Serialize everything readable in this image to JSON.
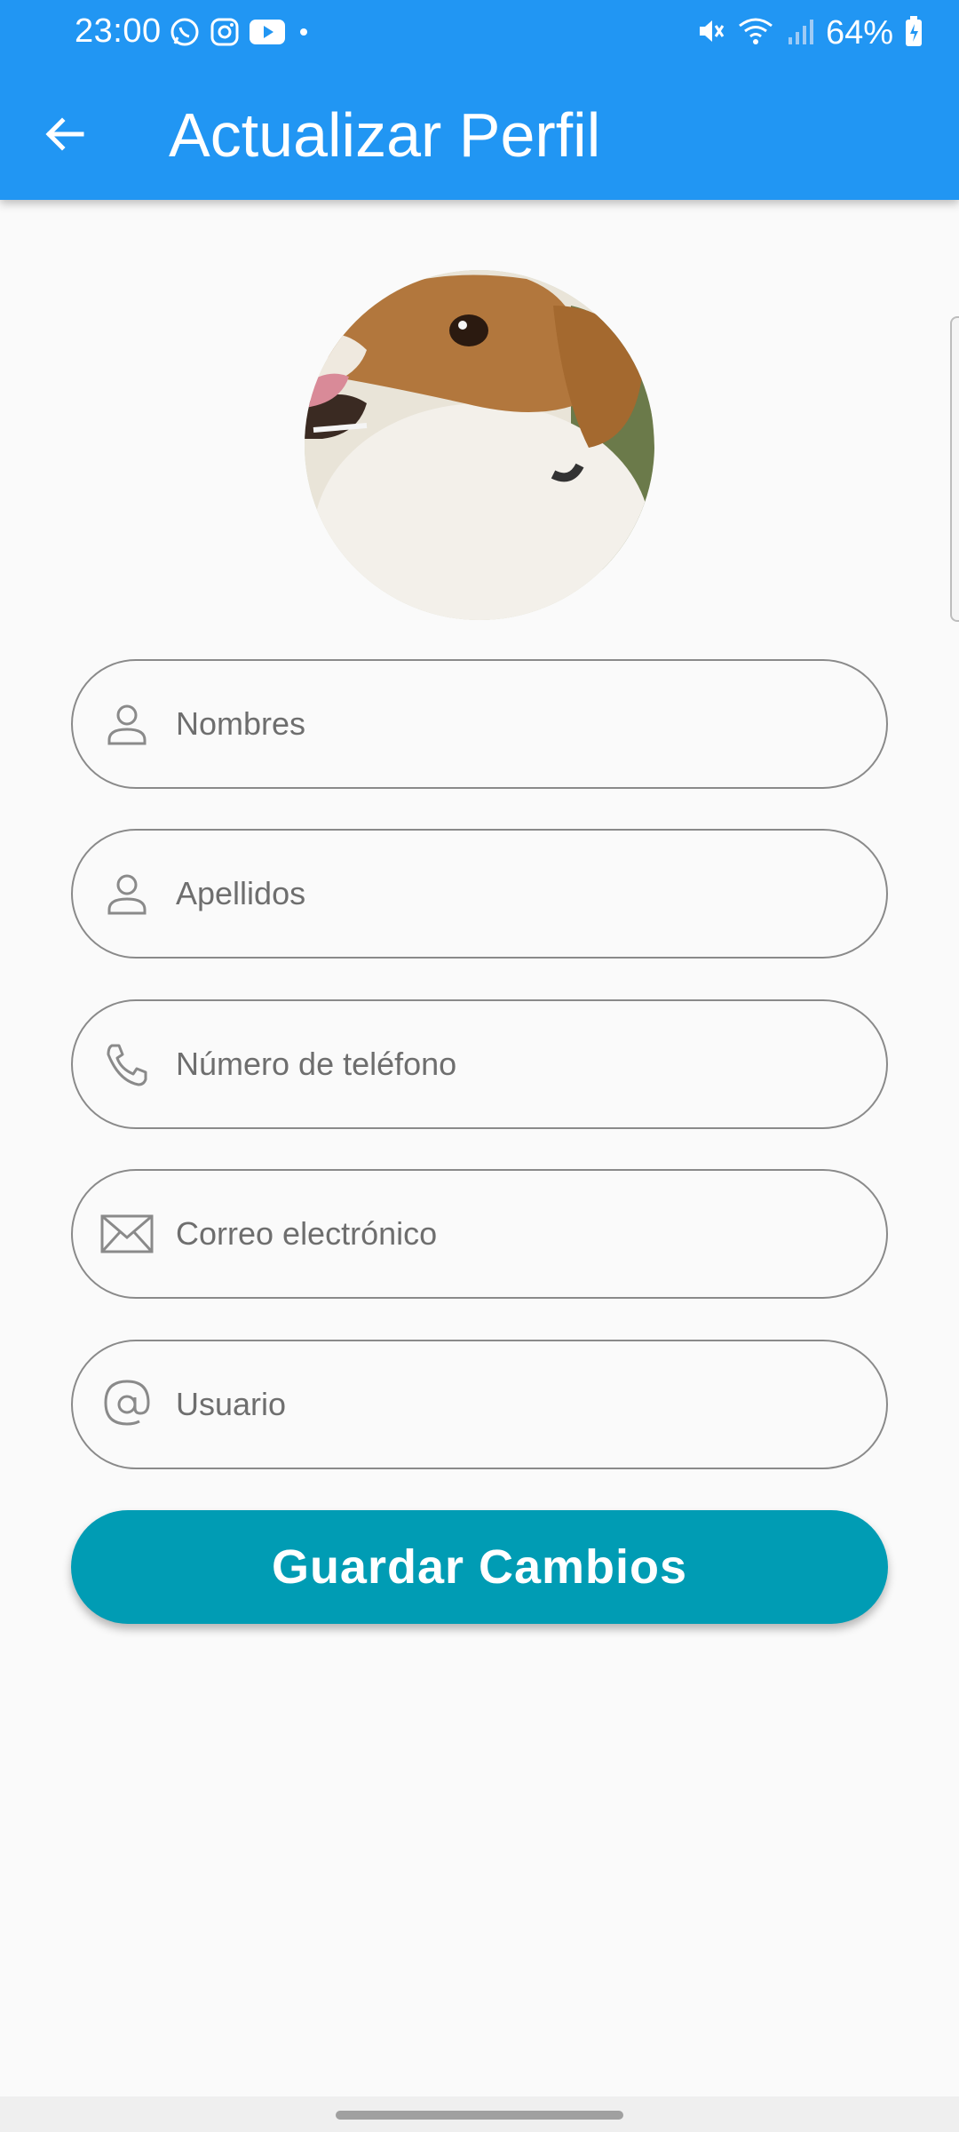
{
  "status_bar": {
    "time": "23:00",
    "battery": "64%",
    "left_icons": [
      "whatsapp-icon",
      "instagram-icon",
      "youtube-icon",
      "dot-icon"
    ],
    "right_icons": [
      "mute-icon",
      "wifi-icon",
      "signal-icon",
      "battery-icon"
    ]
  },
  "app_bar": {
    "title": "Actualizar Perfil",
    "back_icon": "arrow-back-icon",
    "color": "#2196f3"
  },
  "profile": {
    "avatar": "profile-photo"
  },
  "form": {
    "fields": [
      {
        "name": "nombres",
        "placeholder": "Nombres",
        "value": "",
        "icon": "person-icon"
      },
      {
        "name": "apellidos",
        "placeholder": "Apellidos",
        "value": "",
        "icon": "person-icon"
      },
      {
        "name": "telefono",
        "placeholder": "Número de teléfono",
        "value": "",
        "icon": "phone-icon"
      },
      {
        "name": "correo",
        "placeholder": "Correo electrónico",
        "value": "",
        "icon": "mail-icon"
      },
      {
        "name": "usuario",
        "placeholder": "Usuario",
        "value": "",
        "icon": "at-icon"
      }
    ],
    "save_label": "Guardar Cambios",
    "save_color": "#009cb4"
  }
}
